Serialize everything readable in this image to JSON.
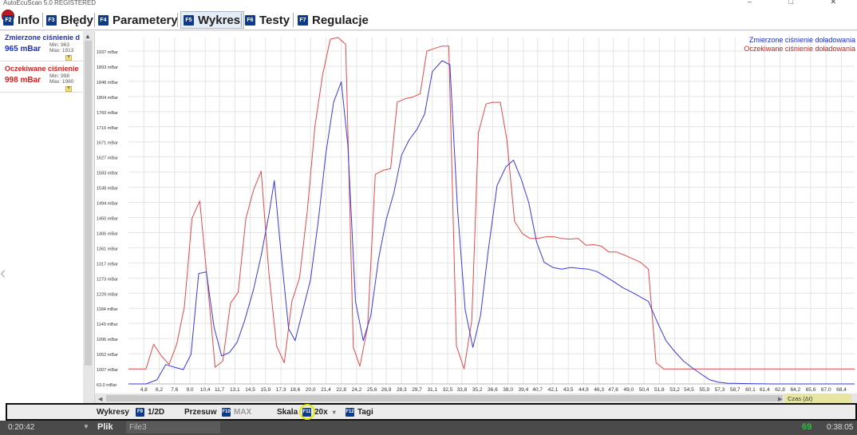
{
  "window": {
    "title": "AutoEcuScan 5.0 REGISTERED",
    "controls": [
      "–",
      "□",
      "✕"
    ]
  },
  "tabs": [
    {
      "key": "F2",
      "label": "Info",
      "active": false
    },
    {
      "key": "F3",
      "label": "Błędy",
      "active": false
    },
    {
      "key": "F4",
      "label": "Parametery",
      "active": false
    },
    {
      "key": "F5",
      "label": "Wykres",
      "active": true
    },
    {
      "key": "F6",
      "label": "Testy",
      "active": false
    },
    {
      "key": "F7",
      "label": "Regulacje",
      "active": false
    }
  ],
  "sensors": [
    {
      "name": "Zmierzone ciśnienie d",
      "value": "965 mBar",
      "min": "Min: 963",
      "max": "Max: 1913",
      "color": "#1a2fc8",
      "btn": "Y"
    },
    {
      "name": "Oczekiwane ciśnienie",
      "value": "998 mBar",
      "min": "Min: 998",
      "max": "Max: 1980",
      "color": "#d42020",
      "btn": "Y"
    }
  ],
  "chart_data": {
    "type": "line",
    "y_tick_labels": [
      "1937 mBar",
      "1893 mBar",
      "1848 mBar",
      "1804 mBar",
      "1760 mBar",
      "1716 mBar",
      "1671 mBar",
      "1627 mBar",
      "1583 mBar",
      "1538 mBar",
      "1494 mBar",
      "1450 mBar",
      "1406 mBar",
      "1361 mBar",
      "1317 mBar",
      "1273 mBar",
      "1229 mBar",
      "1184 mBar",
      "1140 mBar",
      "1096 mBar",
      "1052 mBar",
      "1007 mBar",
      "63,0 mBar"
    ],
    "x_tick_labels": [
      "4,8",
      "6,2",
      "7,6",
      "9,0",
      "10,4",
      "11,7",
      "13,1",
      "14,5",
      "15,9",
      "17,3",
      "18,6",
      "20,0",
      "21,4",
      "22,8",
      "24,2",
      "25,6",
      "26,9",
      "28,3",
      "29,7",
      "31,1",
      "32,5",
      "33,8",
      "35,2",
      "36,6",
      "38,0",
      "39,4",
      "40,7",
      "42,1",
      "43,5",
      "44,9",
      "46,3",
      "47,6",
      "49,0",
      "50,4",
      "51,8",
      "53,2",
      "54,5",
      "55,9",
      "57,3",
      "58,7",
      "60,1",
      "61,4",
      "62,8",
      "64,2",
      "65,6",
      "67,0",
      "68,4"
    ],
    "xlim": [
      3.4,
      69.6
    ],
    "ylim": [
      963,
      1980
    ],
    "xlabel": "Czas (Δt)",
    "legend_position": "top-right",
    "grid": true,
    "series": [
      {
        "name": "Zmierzone ciśnienie doładowania",
        "color": "#3a3adc",
        "points": [
          [
            3.4,
            963
          ],
          [
            5.0,
            963
          ],
          [
            6.0,
            975
          ],
          [
            6.8,
            1020
          ],
          [
            7.6,
            1012
          ],
          [
            8.4,
            1005
          ],
          [
            9.1,
            1050
          ],
          [
            9.8,
            1287
          ],
          [
            10.5,
            1292
          ],
          [
            11.2,
            1130
          ],
          [
            11.9,
            1045
          ],
          [
            12.6,
            1055
          ],
          [
            13.3,
            1085
          ],
          [
            14.0,
            1150
          ],
          [
            14.8,
            1240
          ],
          [
            15.5,
            1340
          ],
          [
            16.2,
            1460
          ],
          [
            16.7,
            1560
          ],
          [
            17.3,
            1350
          ],
          [
            18.0,
            1125
          ],
          [
            18.6,
            1090
          ],
          [
            19.3,
            1180
          ],
          [
            20.0,
            1270
          ],
          [
            20.7,
            1440
          ],
          [
            21.4,
            1640
          ],
          [
            22.1,
            1790
          ],
          [
            22.8,
            1850
          ],
          [
            23.4,
            1665
          ],
          [
            24.1,
            1205
          ],
          [
            24.8,
            1090
          ],
          [
            25.5,
            1165
          ],
          [
            26.2,
            1330
          ],
          [
            26.9,
            1445
          ],
          [
            27.6,
            1525
          ],
          [
            28.3,
            1635
          ],
          [
            29.0,
            1680
          ],
          [
            29.7,
            1710
          ],
          [
            30.4,
            1755
          ],
          [
            31.1,
            1880
          ],
          [
            32.0,
            1912
          ],
          [
            32.7,
            1900
          ],
          [
            33.4,
            1475
          ],
          [
            34.1,
            1180
          ],
          [
            34.8,
            1070
          ],
          [
            35.5,
            1165
          ],
          [
            36.2,
            1355
          ],
          [
            37.0,
            1545
          ],
          [
            37.8,
            1600
          ],
          [
            38.5,
            1620
          ],
          [
            39.2,
            1565
          ],
          [
            39.9,
            1495
          ],
          [
            40.6,
            1380
          ],
          [
            41.3,
            1320
          ],
          [
            42.1,
            1305
          ],
          [
            42.9,
            1300
          ],
          [
            43.7,
            1305
          ],
          [
            44.5,
            1302
          ],
          [
            45.3,
            1300
          ],
          [
            46.1,
            1293
          ],
          [
            46.9,
            1278
          ],
          [
            47.7,
            1262
          ],
          [
            48.5,
            1245
          ],
          [
            49.3,
            1232
          ],
          [
            50.1,
            1218
          ],
          [
            50.8,
            1205
          ],
          [
            51.6,
            1145
          ],
          [
            52.4,
            1090
          ],
          [
            53.2,
            1058
          ],
          [
            54.0,
            1030
          ],
          [
            54.8,
            1010
          ],
          [
            55.6,
            992
          ],
          [
            56.4,
            975
          ],
          [
            57.2,
            968
          ],
          [
            58.0,
            965
          ],
          [
            60.0,
            964
          ],
          [
            62.0,
            963
          ],
          [
            64.0,
            963
          ],
          [
            66.0,
            963
          ],
          [
            69.6,
            963
          ]
        ]
      },
      {
        "name": "Oczekiwane ciśnienie doładowania",
        "color": "#e34a4a",
        "points": [
          [
            3.4,
            1007
          ],
          [
            5.0,
            1007
          ],
          [
            5.7,
            1080
          ],
          [
            6.4,
            1045
          ],
          [
            7.1,
            1020
          ],
          [
            7.8,
            1080
          ],
          [
            8.5,
            1190
          ],
          [
            9.2,
            1450
          ],
          [
            9.9,
            1500
          ],
          [
            10.6,
            1260
          ],
          [
            11.3,
            1012
          ],
          [
            12.0,
            1030
          ],
          [
            12.7,
            1200
          ],
          [
            13.4,
            1232
          ],
          [
            14.1,
            1448
          ],
          [
            14.8,
            1532
          ],
          [
            15.5,
            1588
          ],
          [
            16.2,
            1288
          ],
          [
            16.9,
            1075
          ],
          [
            17.6,
            1025
          ],
          [
            18.3,
            1205
          ],
          [
            19.0,
            1275
          ],
          [
            19.7,
            1470
          ],
          [
            20.4,
            1720
          ],
          [
            21.1,
            1870
          ],
          [
            21.8,
            1975
          ],
          [
            22.5,
            1980
          ],
          [
            23.2,
            1960
          ],
          [
            23.9,
            1070
          ],
          [
            24.5,
            1015
          ],
          [
            25.2,
            1130
          ],
          [
            25.9,
            1578
          ],
          [
            26.6,
            1590
          ],
          [
            27.3,
            1595
          ],
          [
            27.9,
            1790
          ],
          [
            28.6,
            1800
          ],
          [
            29.3,
            1805
          ],
          [
            30.0,
            1815
          ],
          [
            30.6,
            1940
          ],
          [
            31.3,
            1948
          ],
          [
            32.0,
            1955
          ],
          [
            32.6,
            1955
          ],
          [
            33.3,
            1075
          ],
          [
            34.0,
            1007
          ],
          [
            34.7,
            1150
          ],
          [
            35.3,
            1700
          ],
          [
            36.0,
            1785
          ],
          [
            36.6,
            1790
          ],
          [
            37.3,
            1790
          ],
          [
            37.9,
            1680
          ],
          [
            38.6,
            1440
          ],
          [
            39.3,
            1405
          ],
          [
            40.0,
            1390
          ],
          [
            40.7,
            1390
          ],
          [
            41.5,
            1395
          ],
          [
            42.2,
            1395
          ],
          [
            42.9,
            1390
          ],
          [
            43.6,
            1388
          ],
          [
            44.4,
            1390
          ],
          [
            45.1,
            1370
          ],
          [
            45.8,
            1372
          ],
          [
            46.5,
            1368
          ],
          [
            47.2,
            1350
          ],
          [
            47.9,
            1350
          ],
          [
            48.7,
            1340
          ],
          [
            49.4,
            1330
          ],
          [
            50.1,
            1320
          ],
          [
            50.8,
            1300
          ],
          [
            51.5,
            1025
          ],
          [
            52.2,
            1007
          ],
          [
            53.0,
            1007
          ],
          [
            55.0,
            1007
          ],
          [
            58.0,
            1007
          ],
          [
            62.0,
            1007
          ],
          [
            66.0,
            1007
          ],
          [
            69.6,
            1007
          ]
        ]
      }
    ]
  },
  "hscroll": {
    "left_arrow": "◀",
    "right_arrow": "▶",
    "label": "Czas (Δt)"
  },
  "toolbar": {
    "wykresy": "Wykresy",
    "half_key": "F9",
    "half": "1/2D",
    "przesuw": "Przesuw",
    "max_key": "F10",
    "max": "MAX",
    "skala": "Skala",
    "zoom_key": "F11",
    "zoom": "20x",
    "dd": "▾",
    "tagi_key": "F12",
    "tagi": "Tagi"
  },
  "status": {
    "time_left": "0:20:42",
    "dd": "▼",
    "plik": "Plik",
    "file": "File3",
    "count": "69",
    "time_right": "0:38:05"
  }
}
